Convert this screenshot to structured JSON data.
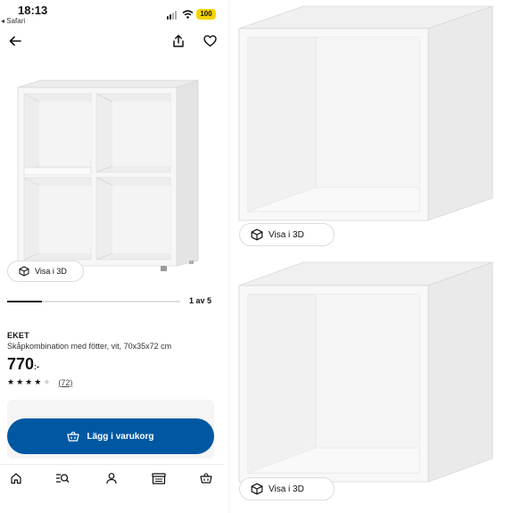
{
  "status_bar": {
    "time": "18:13",
    "back_app": "◂ Safari",
    "battery": "100",
    "battery_color": "#f5d400"
  },
  "nav": {
    "back_icon": "arrow-left-icon",
    "share_icon": "share-icon",
    "favorite_icon": "heart-icon"
  },
  "gallery": {
    "view_3d_label": "Visa i 3D",
    "page_indicator": "1 av 5",
    "progress": 0.2
  },
  "product": {
    "name": "EKET",
    "description": "Skåpkombination med fötter, vit, 70x35x72 cm",
    "price": "770",
    "currency": ":-",
    "rating": 4,
    "rating_max": 5,
    "review_count": "(72)"
  },
  "cart": {
    "button_label": "Lägg i varukorg",
    "button_color": "#0058a3",
    "icon": "basket-icon"
  },
  "tabbar": {
    "items": [
      {
        "icon": "home-icon"
      },
      {
        "icon": "search-list-icon"
      },
      {
        "icon": "profile-icon"
      },
      {
        "icon": "store-icon"
      },
      {
        "icon": "basket-icon"
      }
    ]
  },
  "right_images": [
    {
      "view_3d_label": "Visa i 3D"
    },
    {
      "view_3d_label": "Visa i 3D"
    }
  ]
}
